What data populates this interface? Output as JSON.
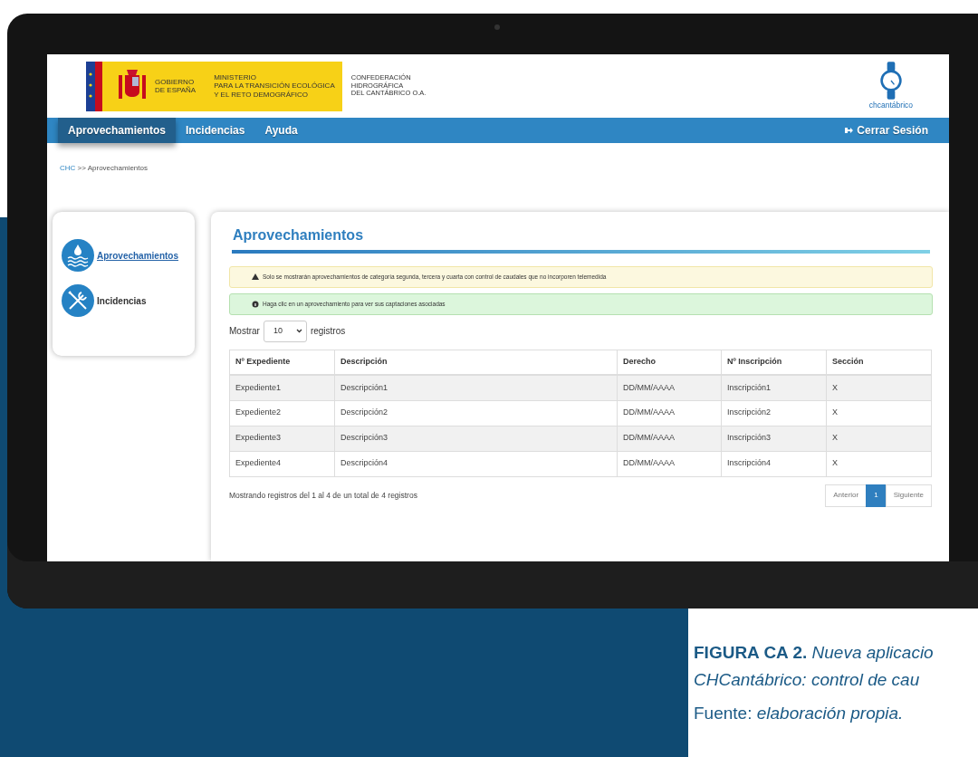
{
  "header": {
    "government_lines": [
      "GOBIERNO",
      "DE ESPAÑA"
    ],
    "ministry_lines": [
      "MINISTERIO",
      "PARA LA TRANSICIÓN ECOLÓGICA",
      "Y EL RETO DEMOGRÁFICO"
    ],
    "agency_lines": [
      "CONFEDERACIÓN",
      "HIDROGRÁFICA",
      "DEL CANTÁBRICO O.A."
    ],
    "brand": "chcantábrico"
  },
  "nav": {
    "items": [
      {
        "label": "Aprovechamientos",
        "selected": true
      },
      {
        "label": "Incidencias",
        "selected": false
      },
      {
        "label": "Ayuda",
        "selected": false
      }
    ],
    "logout": "Cerrar Sesión"
  },
  "breadcrumb": {
    "link": "CHC",
    "separator": ">>",
    "current": "Aprovechamientos"
  },
  "sidebar": {
    "items": [
      {
        "label": "Aprovechamientos",
        "kind": "water",
        "selected": true
      },
      {
        "label": "Incidencias",
        "kind": "tools",
        "selected": false
      }
    ]
  },
  "main": {
    "title": "Aprovechamientos",
    "alerts": [
      {
        "kind": "warning",
        "text": "Solo se mostrarán aprovechamientos de categoría segunda, tercera y cuarta con control de caudales que no incorporen telemedida"
      },
      {
        "kind": "info",
        "text": "Haga clic en un aprovechamiento para ver sus captaciones asociadas"
      }
    ],
    "length": {
      "prefix": "Mostrar",
      "value": "10",
      "suffix": "registros"
    },
    "table": {
      "columns": [
        "Nº Expediente",
        "Descripción",
        "Derecho",
        "Nº Inscripción",
        "Sección"
      ],
      "rows": [
        [
          "Expediente1",
          "Descripción1",
          "DD/MM/AAAA",
          "Inscripción1",
          "X"
        ],
        [
          "Expediente2",
          "Descripción2",
          "DD/MM/AAAA",
          "Inscripción2",
          "X"
        ],
        [
          "Expediente3",
          "Descripción3",
          "DD/MM/AAAA",
          "Inscripción3",
          "X"
        ],
        [
          "Expediente4",
          "Descripción4",
          "DD/MM/AAAA",
          "Inscripción4",
          "X"
        ]
      ]
    },
    "info": "Mostrando registros del 1 al 4 de un total de 4 registros",
    "pagination": {
      "previous": "Anterior",
      "pages": [
        {
          "label": "1",
          "selected": true
        }
      ],
      "next": "Siguiente"
    }
  },
  "caption": {
    "line_1": "**FIGURA CA 2.** *Nueva aplicacio*",
    "line_2": "CHCantábrico: control de cau",
    "source": "Fuente: *elaboración propia.*"
  }
}
